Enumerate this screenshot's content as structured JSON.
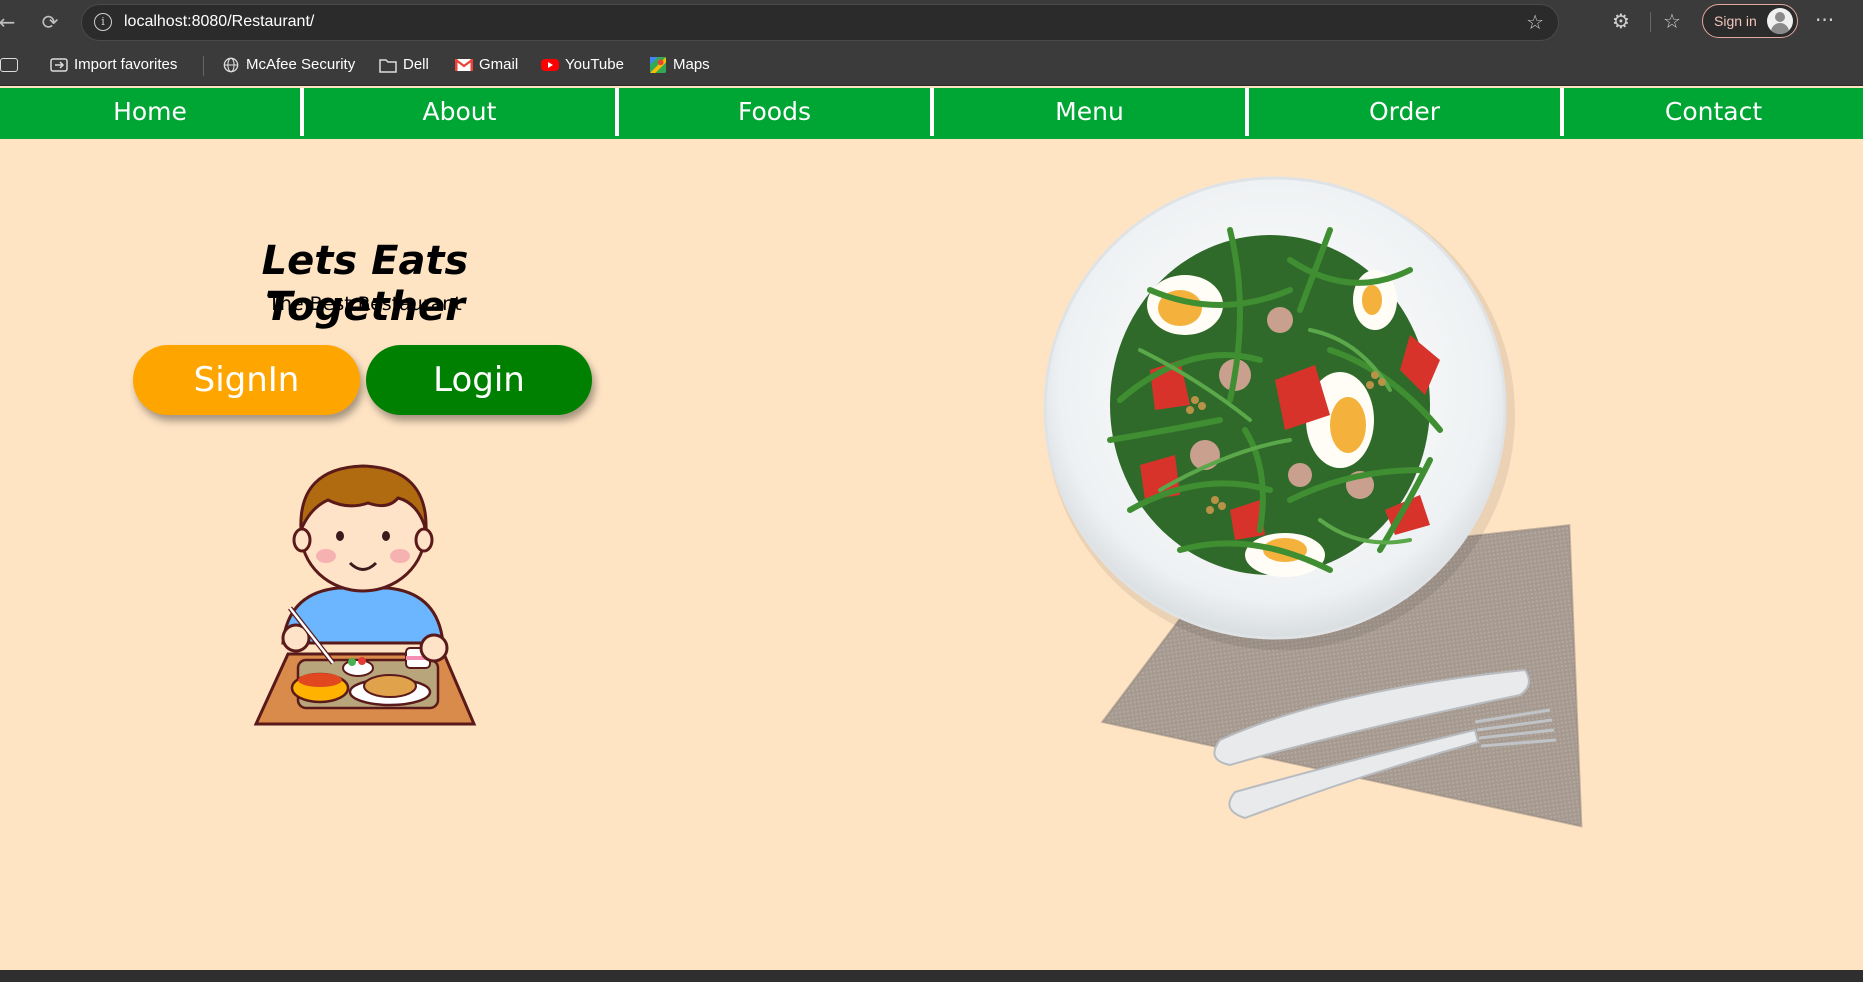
{
  "browser": {
    "url": "localhost:8080/Restaurant/",
    "signin_label": "Sign in",
    "bookmarks": [
      {
        "label": "Import favorites",
        "icon": "import-icon"
      },
      {
        "label": "McAfee Security",
        "icon": "globe-icon"
      },
      {
        "label": "Dell",
        "icon": "folder-icon"
      },
      {
        "label": "Gmail",
        "icon": "gmail-icon"
      },
      {
        "label": "YouTube",
        "icon": "youtube-icon"
      },
      {
        "label": "Maps",
        "icon": "maps-icon"
      }
    ]
  },
  "nav": {
    "items": [
      "Home",
      "About",
      "Foods",
      "Menu",
      "Order",
      "Contact"
    ],
    "color": "#00a633"
  },
  "hero": {
    "title": "Lets Eats Together",
    "subtitle": "The Best Restaurant",
    "signin_button": "SignIn",
    "login_button": "Login"
  },
  "colors": {
    "background": "#ffe4c4",
    "signin": "#ffa500",
    "login": "#008000"
  }
}
